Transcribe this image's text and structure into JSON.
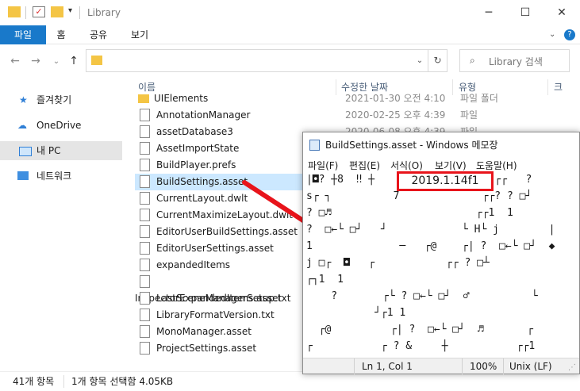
{
  "titlebar": {
    "title": "Library"
  },
  "ribbon": {
    "tabs": [
      "파일",
      "홈",
      "공유",
      "보기"
    ]
  },
  "search": {
    "placeholder": "Library 검색"
  },
  "sidebar": {
    "items": [
      {
        "label": "즐겨찾기",
        "icon": "star-icon"
      },
      {
        "label": "OneDrive",
        "icon": "cloud-icon"
      },
      {
        "label": "내 PC",
        "icon": "pc-icon"
      },
      {
        "label": "네트워크",
        "icon": "network-icon"
      }
    ]
  },
  "columns": {
    "name": "이름",
    "date": "수정한 날짜",
    "type": "유형",
    "size": "크"
  },
  "files": [
    {
      "name": "UIElements",
      "date": "2021-01-30 오전 4:10",
      "type": "파일 폴더",
      "folder": true
    },
    {
      "name": "AnnotationManager",
      "date": "2020-02-25 오후 4:39",
      "type": "파일"
    },
    {
      "name": "assetDatabase3",
      "date": "2020-06-08 오후 4:39",
      "type": "파일"
    },
    {
      "name": "AssetImportState",
      "date": "",
      "type": ""
    },
    {
      "name": "BuildPlayer.prefs",
      "date": "",
      "type": ""
    },
    {
      "name": "BuildSettings.asset",
      "date": "",
      "type": "",
      "selected": true
    },
    {
      "name": "CurrentLayout.dwlt",
      "date": "",
      "type": ""
    },
    {
      "name": "CurrentMaximizeLayout.dwlt",
      "date": "",
      "type": ""
    },
    {
      "name": "EditorUserBuildSettings.asset",
      "date": "",
      "type": ""
    },
    {
      "name": "EditorUserSettings.asset",
      "date": "",
      "type": ""
    },
    {
      "name": "expandedItems",
      "date": "",
      "type": ""
    },
    {
      "name": "InspectorExpandedItems.asset",
      "date": "",
      "type": ""
    },
    {
      "name": "LastSceneManagerSetup.txt",
      "date": "",
      "type": ""
    },
    {
      "name": "LibraryFormatVersion.txt",
      "date": "",
      "type": ""
    },
    {
      "name": "MonoManager.asset",
      "date": "",
      "type": ""
    },
    {
      "name": "ProjectSettings.asset",
      "date": "",
      "type": ""
    }
  ],
  "status": {
    "count": "41개 항목",
    "selection": "1개 항목 선택함 4.05KB"
  },
  "notepad": {
    "title": "BuildSettings.asset - Windows 메모장",
    "menu": [
      "파일(F)",
      "편집(E)",
      "서식(O)",
      "보기(V)",
      "도움말(H)"
    ],
    "version": "2019.1.14f1",
    "lines": [
      "|◘? ┼8  ‼ ┼",
      "s┌ ┐          7",
      "? □♬",
      "?  □←└ □┘   ┘",
      "1              ─   ┌@",
      "j □┌  ◘   ┌",
      "┌┐1  1",
      "    ?",
      "           ┘┌1 1",
      "  ┌@",
      "┌           ┌ ? &"
    ],
    "lines_right": [
      "    ┌┌   ?",
      "  ┌┌? ? □┘",
      " ┌┌1  1",
      "└ H└ j        |",
      "┌| ?  □←└ □┘  ◆",
      "┌┌ ? □┴",
      "",
      "┌└ ? □←└ □┘  ♂          └",
      "",
      "┌| ?  □←└ □┘  ♬       ┌",
      "       ┼           ┌┌1"
    ],
    "status": {
      "position": "Ln 1, Col 1",
      "zoom": "100%",
      "eol": "Unix (LF)"
    }
  }
}
